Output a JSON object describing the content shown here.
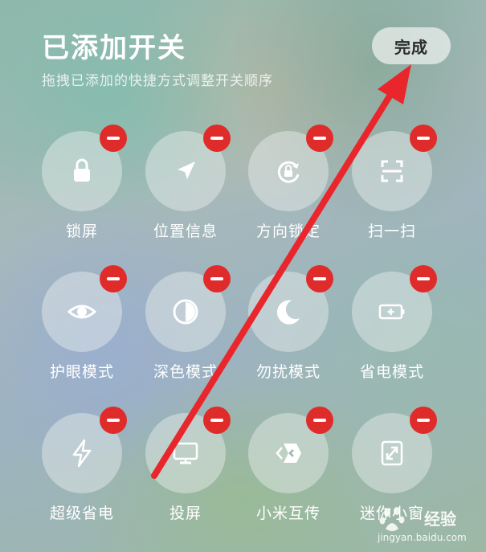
{
  "header": {
    "title": "已添加开关",
    "subtitle": "拖拽已添加的快捷方式调整开关顺序",
    "done_label": "完成"
  },
  "tiles": [
    {
      "label": "锁屏",
      "icon": "lock-icon"
    },
    {
      "label": "位置信息",
      "icon": "location-arrow-icon"
    },
    {
      "label": "方向锁定",
      "icon": "rotation-lock-icon"
    },
    {
      "label": "扫一扫",
      "icon": "scan-icon"
    },
    {
      "label": "护眼模式",
      "icon": "eye-icon"
    },
    {
      "label": "深色模式",
      "icon": "dark-mode-icon"
    },
    {
      "label": "勿扰模式",
      "icon": "moon-icon"
    },
    {
      "label": "省电模式",
      "icon": "battery-saver-icon"
    },
    {
      "label": "超级省电",
      "icon": "lightning-icon"
    },
    {
      "label": "投屏",
      "icon": "screen-cast-icon"
    },
    {
      "label": "小米互传",
      "icon": "mi-share-icon"
    },
    {
      "label": "迷你小窗",
      "icon": "mini-window-icon"
    }
  ],
  "colors": {
    "badge": "#e02b2b",
    "annotation_arrow": "#e8262c"
  },
  "watermark": {
    "brand": "经验",
    "url": "jingyan.baidu.com"
  }
}
